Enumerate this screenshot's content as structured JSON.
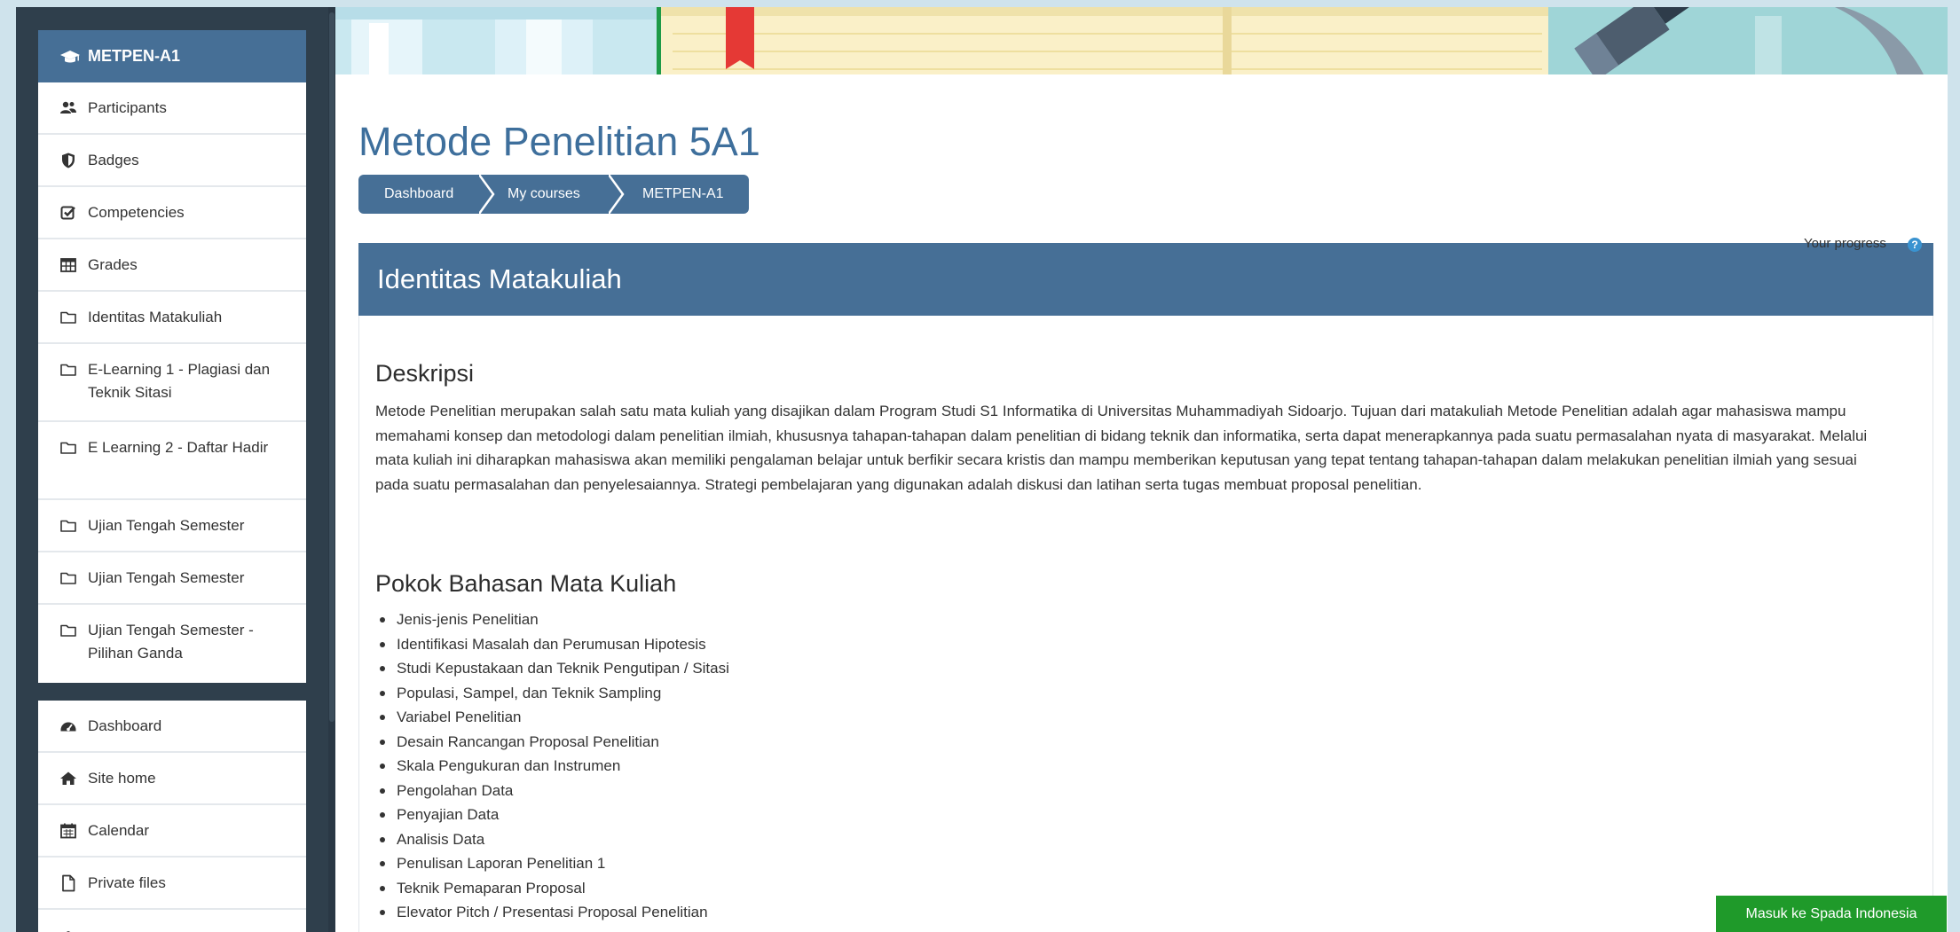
{
  "sidebar": {
    "course_block": {
      "header_label": "METPEN-A1",
      "header_icon": "graduation-cap-icon",
      "items": [
        {
          "label": "Participants",
          "icon": "users-icon"
        },
        {
          "label": "Badges",
          "icon": "shield-icon"
        },
        {
          "label": "Competencies",
          "icon": "checkbox-icon"
        },
        {
          "label": "Grades",
          "icon": "table-icon"
        },
        {
          "label": "Identitas Matakuliah",
          "icon": "folder-icon"
        },
        {
          "label": "E-Learning 1 - Plagiasi dan Teknik Sitasi",
          "icon": "folder-icon"
        },
        {
          "label": "E Learning 2 - Daftar Hadir",
          "icon": "folder-icon"
        },
        {
          "label": "Ujian Tengah Semester",
          "icon": "folder-icon"
        },
        {
          "label": "Ujian Tengah Semester",
          "icon": "folder-icon"
        },
        {
          "label": "Ujian Tengah Semester - Pilihan Ganda",
          "icon": "folder-icon"
        }
      ]
    },
    "nav_block": {
      "items": [
        {
          "label": "Dashboard",
          "icon": "tachometer-icon"
        },
        {
          "label": "Site home",
          "icon": "home-icon"
        },
        {
          "label": "Calendar",
          "icon": "calendar-icon"
        },
        {
          "label": "Private files",
          "icon": "file-icon"
        }
      ]
    }
  },
  "page": {
    "title": "Metode Penelitian 5A1",
    "breadcrumb": [
      "Dashboard",
      "My courses",
      "METPEN-A1"
    ],
    "progress_label": "Your progress",
    "progress_help": "?"
  },
  "section": {
    "title": "Identitas Matakuliah",
    "description_heading": "Deskripsi",
    "description": "Metode Penelitian merupakan salah satu mata kuliah yang disajikan dalam Program Studi S1 Informatika di Universitas Muhammadiyah Sidoarjo. Tujuan dari matakuliah Metode Penelitian adalah agar mahasiswa mampu memahami konsep dan metodologi dalam penelitian ilmiah, khususnya tahapan-tahapan dalam penelitian di bidang teknik dan informatika, serta dapat menerapkannya pada suatu permasalahan nyata di masyarakat. Melalui mata kuliah ini diharapkan mahasiswa akan memiliki pengalaman belajar untuk berfikir secara kristis dan mampu memberikan keputusan yang tepat tentang tahapan-tahapan dalam melakukan penelitian ilmiah yang sesuai pada suatu permasalahan dan penyelesaiannya. Strategi pembelajaran yang digunakan adalah diskusi dan latihan serta tugas membuat proposal penelitian.",
    "topics_heading": "Pokok Bahasan Mata Kuliah",
    "topics": [
      "Jenis-jenis Penelitian",
      "Identifikasi Masalah dan Perumusan Hipotesis",
      "Studi Kepustakaan dan Teknik Pengutipan / Sitasi",
      "Populasi, Sampel, dan Teknik Sampling",
      "Variabel Penelitian",
      "Desain Rancangan Proposal Penelitian",
      "Skala Pengukuran dan Instrumen",
      "Pengolahan Data",
      "Penyajian Data",
      "Analisis Data",
      "Penulisan Laporan Penelitian 1",
      "Teknik Pemaparan Proposal",
      "Elevator Pitch / Presentasi Proposal Penelitian"
    ]
  },
  "footer_button": "Masuk ke Spada Indonesia",
  "colors": {
    "primary": "#466f96",
    "title": "#3e6f9c",
    "sidebar_bg": "#2f3f4c",
    "button_green": "#1f9a2a"
  }
}
